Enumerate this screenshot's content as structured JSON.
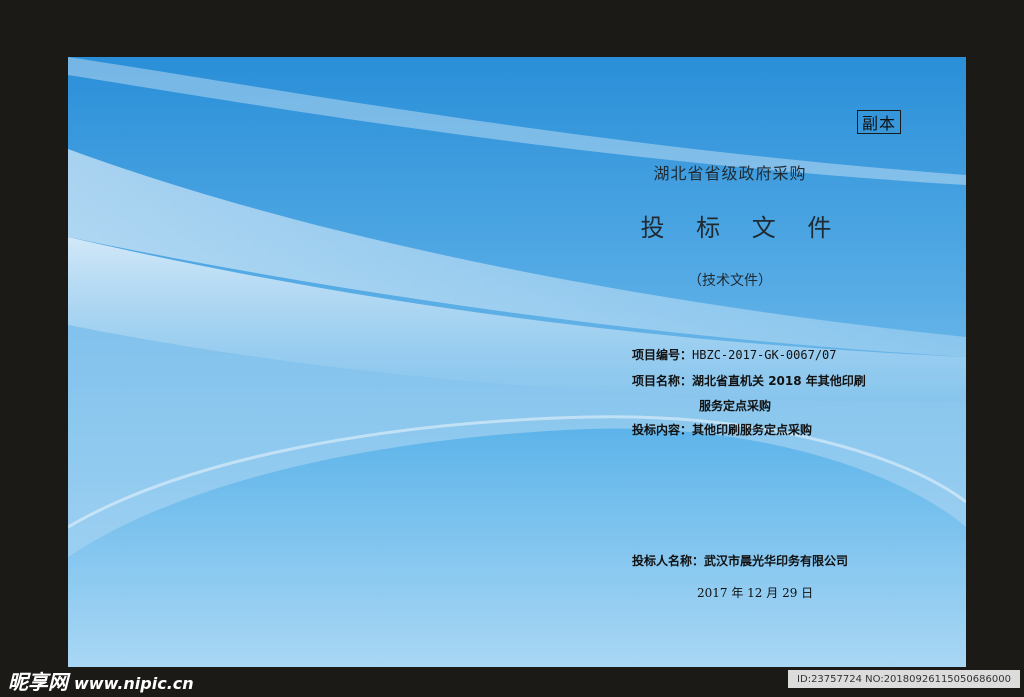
{
  "badge": {
    "copy_label": "副本"
  },
  "header": {
    "organization": "湖北省省级政府采购",
    "title": "投 标 文 件",
    "subtitle": "（技术文件）"
  },
  "details": {
    "project_no_label": "项目编号：",
    "project_no": "HBZC-2017-GK-0067/07",
    "project_name_label": "项目名称：",
    "project_name_line1": "湖北省直机关 2018 年其他印刷",
    "project_name_line2": "服务定点采购",
    "bid_content_label": "投标内容：",
    "bid_content": "其他印刷服务定点采购",
    "bidder_label": "投标人名称：",
    "bidder": "武汉市晨光华印务有限公司",
    "date": "2017 年 12 月 29 日"
  },
  "watermark": {
    "brand": "昵享网",
    "url": "www.nipic.cn",
    "id_text": "ID:23757724 NO:20180926115050686000"
  },
  "colors": {
    "frame": "#1c1a17",
    "sky_top": "#2a8fd8",
    "sky_bottom": "#b6def6"
  }
}
